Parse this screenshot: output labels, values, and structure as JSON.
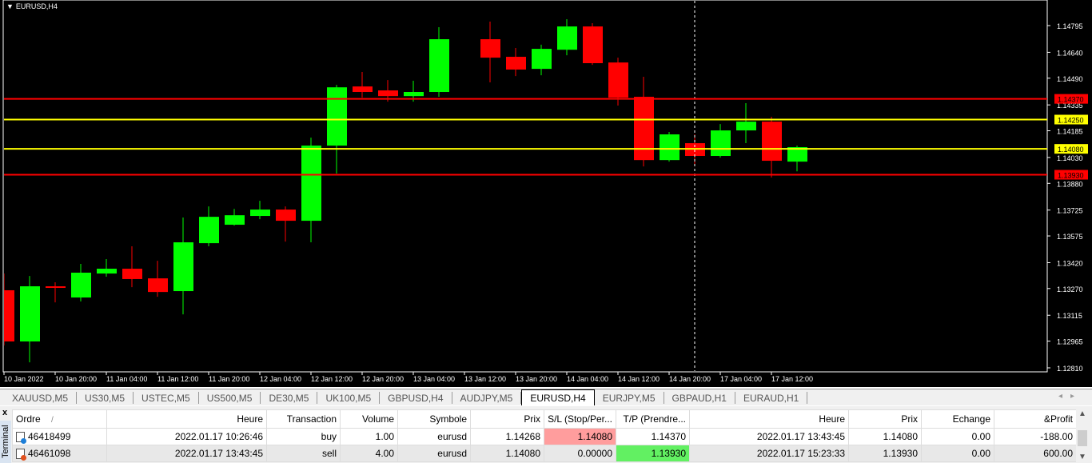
{
  "chart": {
    "title": "EURUSD,H4",
    "colors": {
      "bull": "#00ff00",
      "bear": "#ff0000",
      "background": "#000000",
      "axis": "#ffffff"
    },
    "chart_data": {
      "type": "candlestick",
      "symbol": "EURUSD",
      "timeframe": "H4",
      "ylim": [
        1.1281,
        1.14795
      ],
      "y_ticks": [
        "1.14795",
        "1.14640",
        "1.14490",
        "1.14335",
        "1.14185",
        "1.14030",
        "1.13880",
        "1.13725",
        "1.13575",
        "1.13420",
        "1.13270",
        "1.13115",
        "1.12965",
        "1.12810"
      ],
      "x_ticks": [
        "10 Jan 2022",
        "10 Jan 20:00",
        "11 Jan 04:00",
        "11 Jan 12:00",
        "11 Jan 20:00",
        "12 Jan 04:00",
        "12 Jan 12:00",
        "12 Jan 20:00",
        "13 Jan 04:00",
        "13 Jan 12:00",
        "13 Jan 20:00",
        "14 Jan 04:00",
        "14 Jan 12:00",
        "14 Jan 20:00",
        "17 Jan 04:00",
        "17 Jan 12:00"
      ],
      "candles": [
        [
          1.1326,
          1.13357,
          1.1294,
          1.12963
        ],
        [
          1.12963,
          1.13343,
          1.12842,
          1.13283
        ],
        [
          1.13283,
          1.13306,
          1.1319,
          1.13278
        ],
        [
          1.13218,
          1.13413,
          1.13195,
          1.13362
        ],
        [
          1.13357,
          1.13441,
          1.13339,
          1.13385
        ],
        [
          1.13385,
          1.13515,
          1.13278,
          1.13325
        ],
        [
          1.13329,
          1.13431,
          1.13222,
          1.1325
        ],
        [
          1.13255,
          1.13682,
          1.1312,
          1.13538
        ],
        [
          1.13533,
          1.13746,
          1.13515,
          1.13686
        ],
        [
          1.1364,
          1.13732,
          1.13635,
          1.13695
        ],
        [
          1.13691,
          1.13779,
          1.13672,
          1.13728
        ],
        [
          1.13728,
          1.13746,
          1.13542,
          1.13663
        ],
        [
          1.13663,
          1.14145,
          1.13538,
          1.14099
        ],
        [
          1.14099,
          1.14451,
          1.13937,
          1.14437
        ],
        [
          1.14442,
          1.14526,
          1.14377,
          1.1441
        ],
        [
          1.14419,
          1.14479,
          1.14354,
          1.14386
        ],
        [
          1.14386,
          1.14475,
          1.14354,
          1.1441
        ],
        [
          1.1441,
          1.14786,
          1.14382,
          1.14716
        ],
        null,
        [
          1.14716,
          1.14818,
          1.14466,
          1.14609
        ],
        [
          1.14614,
          1.14665,
          1.14502,
          1.1454
        ],
        [
          1.14544,
          1.14684,
          1.14507,
          1.1466
        ],
        [
          1.14655,
          1.14832,
          1.14623,
          1.1479
        ],
        [
          1.1479,
          1.14809,
          1.14567,
          1.14577
        ],
        [
          1.14581,
          1.14609,
          1.14331,
          1.14377
        ],
        [
          1.14382,
          1.14498,
          1.13978,
          1.14015
        ],
        [
          1.14015,
          1.14178,
          1.14006,
          1.14164
        ],
        [
          1.14113,
          1.14164,
          1.13992,
          1.14039
        ],
        [
          1.14039,
          1.14224,
          1.14029,
          1.14187
        ],
        [
          1.14187,
          1.14345,
          1.14113,
          1.14238
        ],
        [
          1.14238,
          1.14266,
          1.13914,
          1.14011
        ],
        [
          1.14006,
          1.14099,
          1.1395,
          1.1409
        ]
      ],
      "candle_format": [
        "open",
        "high",
        "low",
        "close"
      ],
      "hlines": [
        {
          "price": "1.14370",
          "color": "#ff0000",
          "label_text": "#000000"
        },
        {
          "price": "1.14250",
          "color": "#ffff00",
          "label_text": "#000000"
        },
        {
          "price": "1.14080",
          "color": "#ffff00",
          "label_text": "#000000"
        },
        {
          "price": "1.13930",
          "color": "#ff0000",
          "label_text": "#000000"
        }
      ],
      "crosshair_candle_index": 27
    }
  },
  "tabs": [
    {
      "label": "XAUUSD,M5"
    },
    {
      "label": "US30,M5"
    },
    {
      "label": "USTEC,M5"
    },
    {
      "label": "US500,M5"
    },
    {
      "label": "DE30,M5"
    },
    {
      "label": "UK100,M5"
    },
    {
      "label": "GBPUSD,H4"
    },
    {
      "label": "AUDJPY,M5"
    },
    {
      "label": "EURUSD,H4",
      "active": true
    },
    {
      "label": "EURJPY,M5"
    },
    {
      "label": "GBPAUD,H1"
    },
    {
      "label": "EURAUD,H1"
    }
  ],
  "terminal": {
    "close": "x",
    "label": "Terminal",
    "columns": [
      "Ordre",
      "Heure",
      "Transaction",
      "Volume",
      "Symbole",
      "Prix",
      "S/L (Stop/Per...",
      "T/P (Prendre...",
      "Heure",
      "Prix",
      "Echange",
      "&Profit"
    ],
    "sort_indicator": "/",
    "rows": [
      {
        "ordre": "46418499",
        "heure": "2022.01.17 10:26:46",
        "transaction": "buy",
        "volume": "1.00",
        "symbole": "eurusd",
        "prix": "1.14268",
        "sl": "1.14080",
        "tp": "1.14370",
        "heure2": "2022.01.17 13:43:45",
        "prix2": "1.14080",
        "echange": "0.00",
        "profit": "-188.00",
        "icon_color": "#1e7fd8"
      },
      {
        "ordre": "46461098",
        "heure": "2022.01.17 13:43:45",
        "transaction": "sell",
        "volume": "4.00",
        "symbole": "eurusd",
        "prix": "1.14080",
        "sl": "0.00000",
        "tp": "1.13930",
        "heure2": "2022.01.17 15:23:33",
        "prix2": "1.13930",
        "echange": "0.00",
        "profit": "600.00",
        "icon_color": "#e0501e"
      }
    ]
  }
}
